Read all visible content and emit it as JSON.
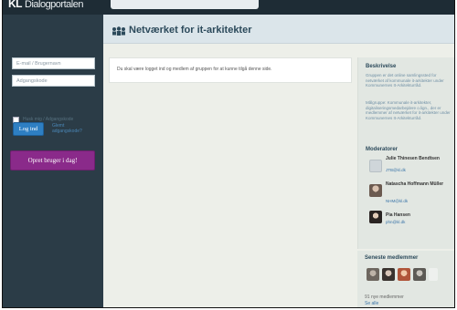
{
  "header": {
    "logo_text": "KL",
    "portal_name": "Dialogportalen"
  },
  "sidebar": {
    "email_placeholder": "E-mail / Brugernavn",
    "password_placeholder": "Adgangskode",
    "remember_label": "Husk mig / Adgangskode",
    "login_label": "Log ind",
    "forgot_label": "Glemt adgangskode?",
    "create_label": "Opret bruger i dag!"
  },
  "page": {
    "title": "Netværket for it-arkitekter",
    "message": "Du skal være logget ind og medlem af gruppen for at kunne tilgå denne side."
  },
  "aside": {
    "description_heading": "Beskrivelse",
    "description_text": "Gruppen er det online samlingssted for netværket af kommunale it-arkitekter under Kommunernes It-Arkitekturråd.",
    "target_text": "Målgruppe: Kommunale it-arkitekter, digitaliseringsmedarbejdere o.lign., der er medlemmer af netværket for it-arkitekter under Kommunernes It-Arkitekturråd.",
    "moderators_heading": "Moderatorer",
    "moderators": [
      {
        "name": "Julie Thinesen Bendtsen",
        "email": "JTB@kl.dk"
      },
      {
        "name": "Natascha Hoffmann Müller",
        "email": "NHM@kl.dk"
      },
      {
        "name": "Pia Hansen",
        "email": "phn@kl.dk"
      }
    ]
  },
  "recent": {
    "heading": "Seneste medlemmer",
    "count_text": "91 nye medlemmer",
    "see_all": "Se alle"
  },
  "colors": {
    "sidebar": "#2b3c47",
    "login_button": "#2e7fc3",
    "create_button": "#8a2a8a",
    "title": "#2c4a5b"
  }
}
